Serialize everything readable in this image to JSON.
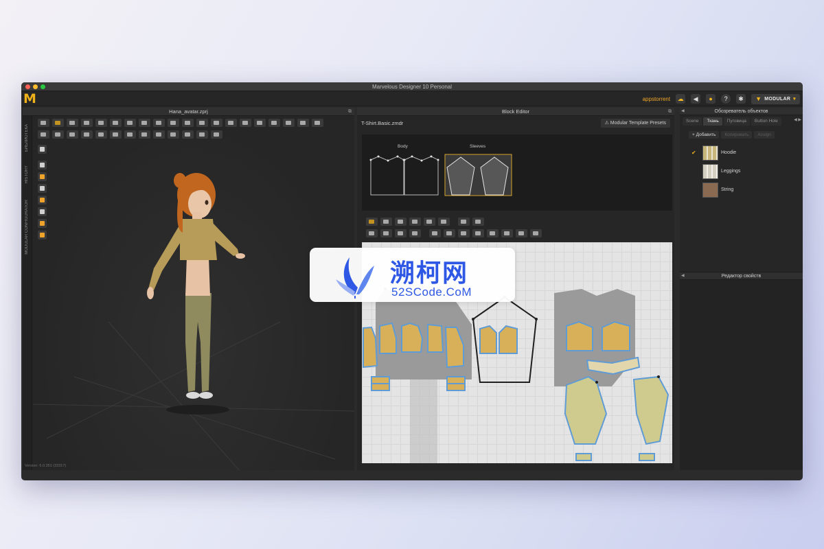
{
  "window": {
    "title": "Marvelous Designer 10 Personal"
  },
  "appbar": {
    "logo": "M",
    "username": "appstorrent",
    "modular_label": "MODULAR"
  },
  "left_panel": {
    "title": "Hana_avatar.zprj",
    "side_tabs": [
      "БИБЛИОТЕКА",
      "HISTORY",
      "MODULAR CONFIGURATOR"
    ],
    "version": "Version: 6.0.351 (33317)"
  },
  "block_editor": {
    "title": "Block Editor",
    "file": "T-Shirt.Basic.zmdr",
    "preset_button": "⚠ Modular Template Presets",
    "groups": [
      {
        "label": "Body"
      },
      {
        "label": "Sleeves"
      }
    ]
  },
  "object_browser": {
    "title": "Обозреватель объектов",
    "tabs": [
      "Scene",
      "Ткань",
      "Пуговица",
      "Button Hole"
    ],
    "active_tab": "Ткань",
    "actions": [
      "+ Добавить",
      "Копировать",
      "Assign"
    ],
    "fabrics": [
      {
        "name": "Hoodie",
        "checked": true,
        "color": "#c8b57a"
      },
      {
        "name": "Leggings",
        "checked": false,
        "color": "#d3d0c2"
      },
      {
        "name": "String",
        "checked": false,
        "color": "#8a6a50"
      }
    ]
  },
  "property_editor": {
    "title": "Редактор свойств"
  },
  "watermark": {
    "title": "溯柯网",
    "subtitle": "52SCode.CoM"
  },
  "colors": {
    "accent": "#f0b21a",
    "pattern_fill": "#d8b05a",
    "pattern_outline": "#5f9bd5"
  }
}
